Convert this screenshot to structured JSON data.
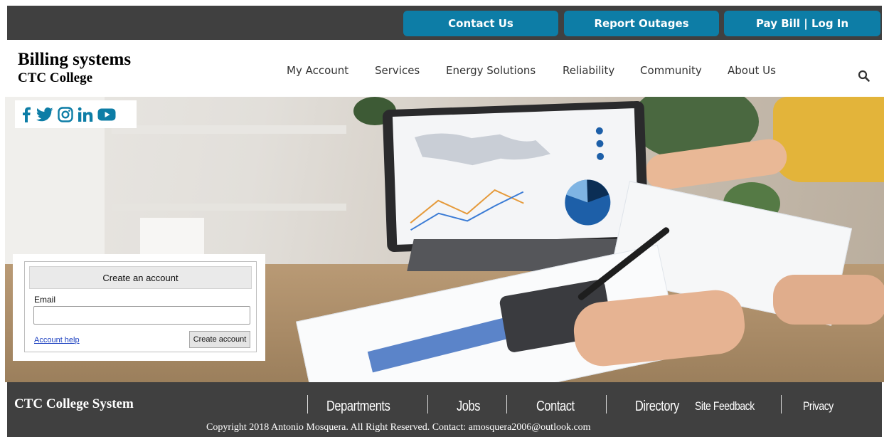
{
  "topbar": {
    "buttons": [
      {
        "label": "Contact Us"
      },
      {
        "label": "Report Outages"
      },
      {
        "label": "Pay Bill | Log In"
      }
    ]
  },
  "header": {
    "title": "Billing systems",
    "subtitle": "CTC College",
    "nav": [
      "My Account",
      "Services",
      "Energy Solutions",
      "Reliability",
      "Community",
      "About Us"
    ]
  },
  "social": [
    "facebook-icon",
    "twitter-icon",
    "instagram-icon",
    "linkedin-icon",
    "youtube-icon"
  ],
  "colors": {
    "accent": "#0d7da6",
    "dark_bar": "#404040"
  },
  "account_panel": {
    "heading": "Create an account",
    "email_label": "Email",
    "email_value": "",
    "help_link": "Account help",
    "create_button": "Create account"
  },
  "footer": {
    "brand": "CTC College System",
    "links": [
      "Departments",
      "Jobs",
      "Contact",
      "Directory",
      "Site Feedback",
      "Privacy"
    ],
    "copyright": "Copyright 2018 Antonio Mosquera. All Right Reserved. Contact: amosquera2006@outlook.com"
  }
}
